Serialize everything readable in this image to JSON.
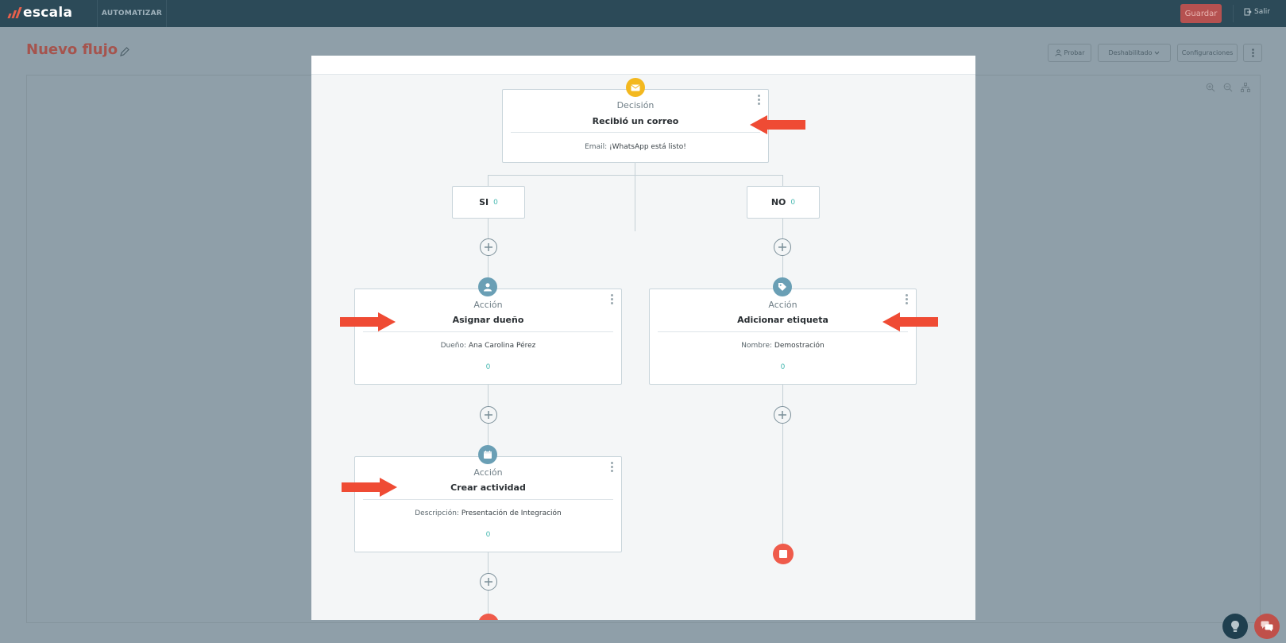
{
  "header": {
    "app_name": "escala",
    "nav_label": "AUTOMATIZAR",
    "save_label": "Guardar",
    "exit_label": "Salir"
  },
  "page": {
    "title": "Nuevo flujo",
    "test_label": "Probar",
    "status_label": "Deshabilitado",
    "settings_label": "Configuraciones"
  },
  "flow": {
    "decision": {
      "type": "Decisión",
      "title": "Recibió un correo",
      "detail_label": "Email: ",
      "detail_value": "¡WhatsApp está listo!"
    },
    "branches": {
      "yes": {
        "label": "SI",
        "count": "0"
      },
      "no": {
        "label": "NO",
        "count": "0"
      }
    },
    "assign_owner": {
      "type": "Acción",
      "title": "Asignar dueño",
      "detail_label": "Dueño: ",
      "detail_value": "Ana Carolina Pérez",
      "count": "0"
    },
    "add_tag": {
      "type": "Acción",
      "title": "Adicionar etiqueta",
      "detail_label": "Nombre: ",
      "detail_value": "Demostración",
      "count": "0"
    },
    "create_activity": {
      "type": "Acción",
      "title": "Crear actividad",
      "detail_label": "Descripción: ",
      "detail_value": "Presentación de Integración",
      "count": "0"
    }
  },
  "colors": {
    "topbar": "#2c4a58",
    "accent": "#ef5b4b",
    "decision_badge": "#f3b81f",
    "action_badge": "#6a9fb5",
    "count": "#46b8b0",
    "annotation_arrow": "#ef4b34"
  },
  "icons": {
    "decision": "envelope-icon",
    "assign_owner": "user-icon",
    "add_tag": "tag-icon",
    "create_activity": "calendar-icon",
    "add_step": "plus-circle-icon",
    "end": "stop-icon"
  }
}
